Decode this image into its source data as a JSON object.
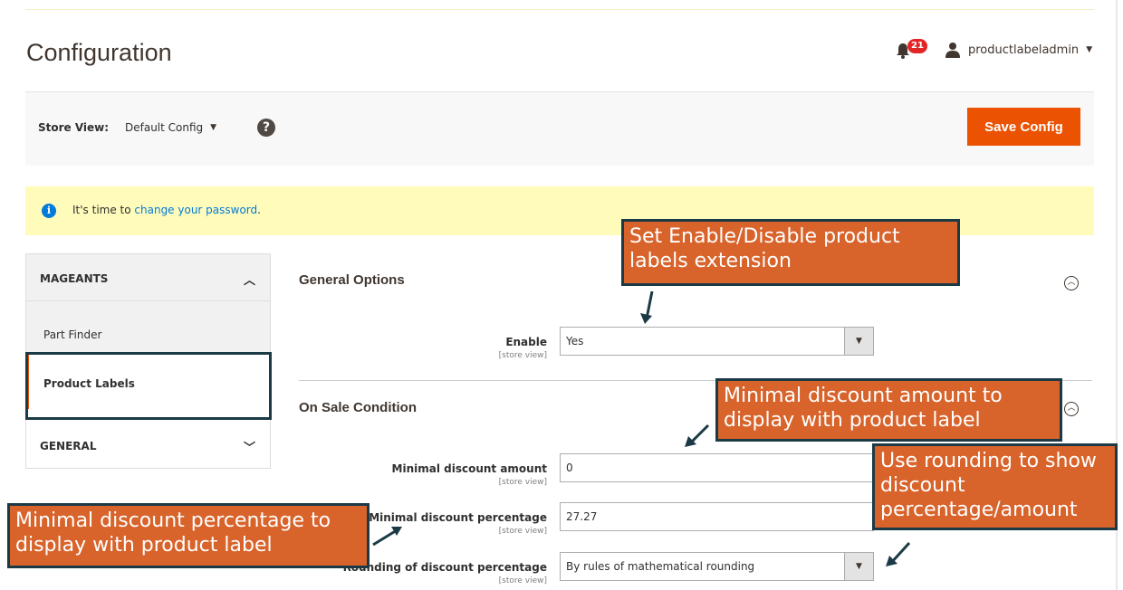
{
  "header": {
    "page_title": "Configuration",
    "notification_count": "21",
    "username": "productlabeladmin"
  },
  "toolbar": {
    "store_view_label": "Store View:",
    "store_view_value": "Default Config",
    "help_symbol": "?",
    "save_label": "Save Config"
  },
  "notice": {
    "prefix": "It's time to ",
    "link_text": "change your password",
    "suffix": "."
  },
  "sidebar": {
    "sections": [
      {
        "label": "MAGEANTS",
        "expanded": true,
        "items": [
          {
            "label": "Part Finder",
            "active": false
          },
          {
            "label": "Product Labels",
            "active": true
          }
        ]
      },
      {
        "label": "GENERAL",
        "expanded": false,
        "items": []
      }
    ]
  },
  "general_options": {
    "title": "General Options",
    "enable_label": "Enable",
    "enable_scope": "[store view]",
    "enable_value": "Yes"
  },
  "on_sale": {
    "title": "On Sale Condition",
    "fields": [
      {
        "label": "Minimal discount amount",
        "scope": "[store view]",
        "value": "0"
      },
      {
        "label": "Minimal discount percentage",
        "scope": "[store view]",
        "value": "27.27"
      },
      {
        "label": "Rounding of discount percentage",
        "scope": "[store view]",
        "value": "By rules of mathematical rounding"
      }
    ]
  },
  "callouts": {
    "enable": "Set Enable/Disable product labels extension",
    "min_amount": "Minimal discount amount to display with product label",
    "rounding": "Use rounding to show discount percentage/amount",
    "min_percentage": "Minimal discount percentage to display with product label"
  },
  "colors": {
    "accent": "#eb5202",
    "callout_bg": "#d8632b",
    "callout_border": "#1c3a45",
    "notice_bg": "#fffbbb",
    "badge": "#e22626",
    "link": "#007bdb"
  }
}
